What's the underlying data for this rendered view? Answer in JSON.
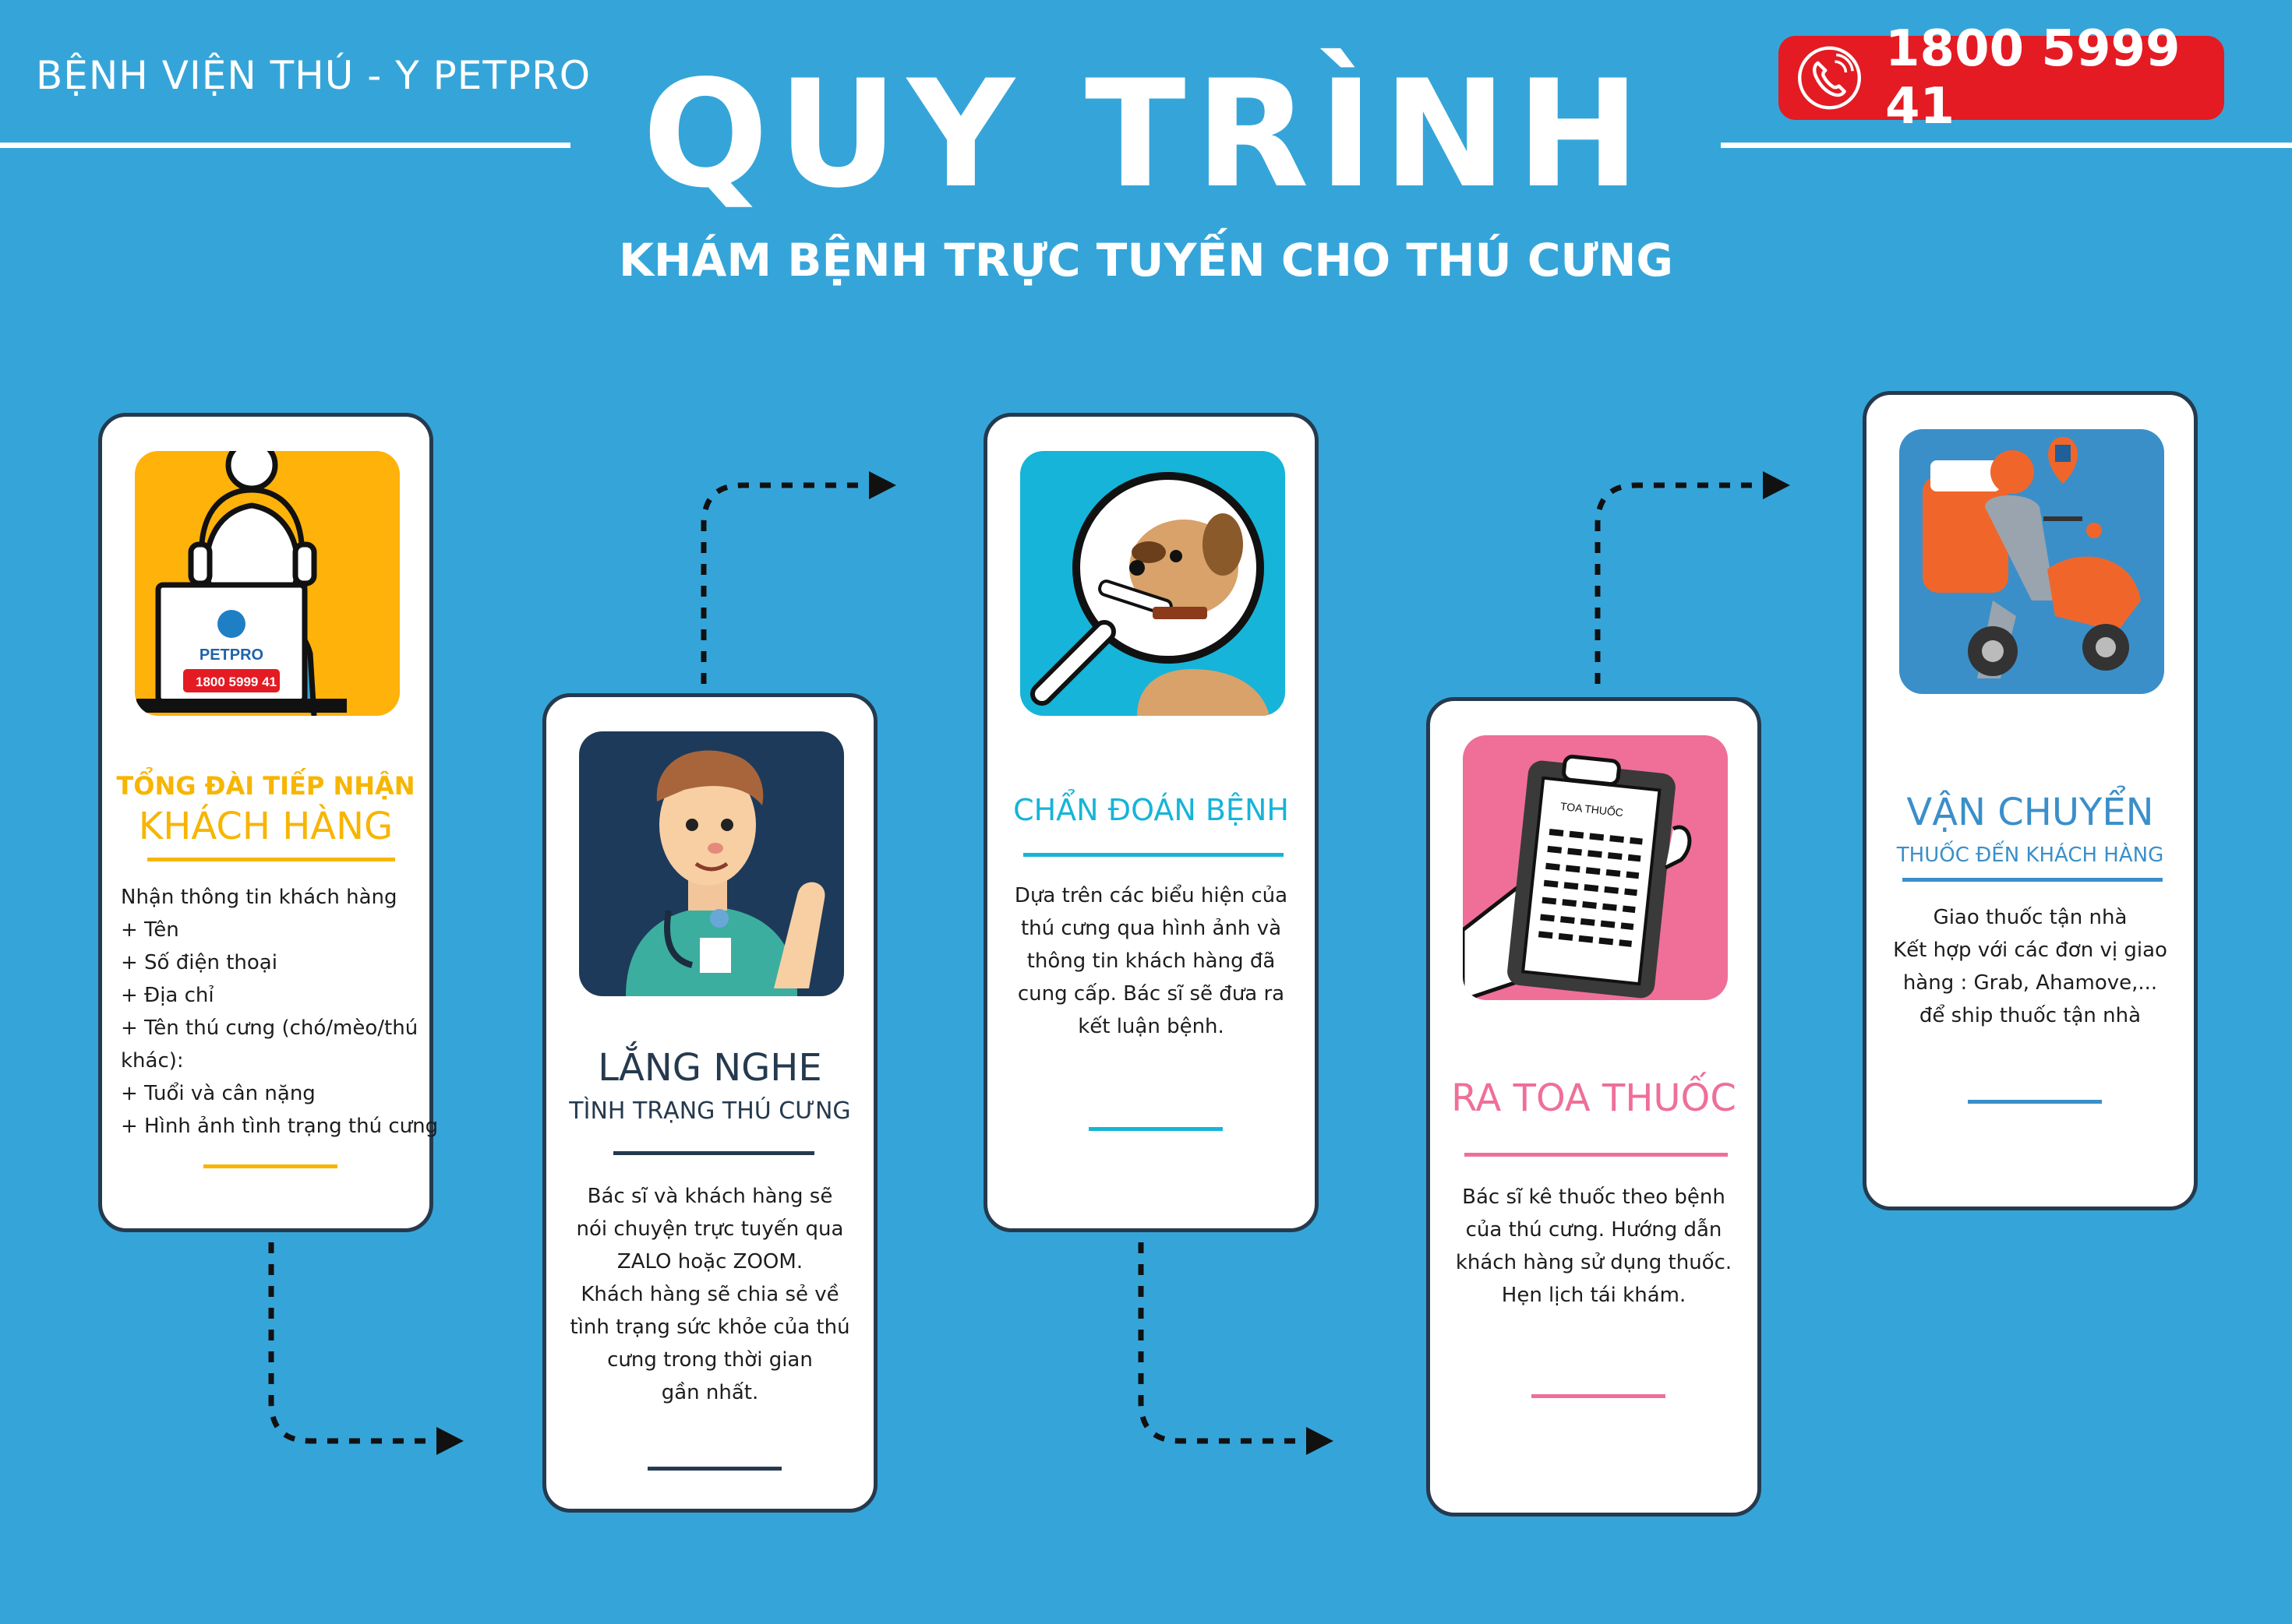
{
  "header": {
    "brand": "BỆNH VIỆN THÚ - Y PETPRO",
    "title": "QUY TRÌNH",
    "subtitle": "KHÁM BỆNH TRỰC TUYẾN CHO THÚ CƯNG",
    "hotline": "1800 5999 41"
  },
  "colors": {
    "background": "#35a5d9",
    "yellow": "#f7b500",
    "navy": "#253a4e",
    "cyan": "#16b4d8",
    "pink": "#ef6f98",
    "blue": "#3a8fc9",
    "red": "#e41b23"
  },
  "steps": [
    {
      "title_line1": "TỔNG ĐÀI TIẾP NHẬN",
      "title_line2": "KHÁCH HÀNG",
      "body": [
        "Nhận thông tin khách hàng",
        "+ Tên",
        "+ Số điện thoại",
        "+ Địa chỉ",
        "+ Tên thú cưng (chó/mèo/thú",
        "khác):",
        "+ Tuổi và cân nặng",
        "+ Hình ảnh tình trạng thú cưng"
      ],
      "icon": "call-center-operator",
      "laptop_brand": "PETPRO",
      "laptop_phone": "1800 5999 41"
    },
    {
      "title_line1": "LẮNG NGHE",
      "title_line2": "TÌNH TRẠNG THÚ CƯNG",
      "body": [
        "Bác sĩ và khách hàng sẽ",
        "nói chuyện trực tuyến qua",
        "ZALO hoặc ZOOM.",
        "Khách hàng sẽ chia sẻ về",
        "tình trạng sức khỏe của thú",
        "cưng trong thời gian",
        "gần nhất."
      ],
      "icon": "veterinarian"
    },
    {
      "title_line1": "CHẨN ĐOÁN BỆNH",
      "body": [
        "Dựa trên các biểu hiện của",
        "thú cưng qua hình ảnh và",
        "thông tin khách hàng đã",
        "cung cấp. Bác sĩ sẽ đưa ra",
        "kết luận bệnh."
      ],
      "icon": "magnifier-dog"
    },
    {
      "title_line1": "RA TOA THUỐC",
      "body": [
        "Bác sĩ kê thuốc theo bệnh",
        "của thú cưng. Hướng dẫn",
        "khách hàng sử dụng thuốc.",
        "Hẹn lịch tái khám."
      ],
      "icon": "prescription-clipboard",
      "clipboard_label": "TOA THUỐC"
    },
    {
      "title_line1": "VẬN CHUYỂN",
      "title_line2": "THUỐC ĐẾN KHÁCH HÀNG",
      "body": [
        "Giao thuốc tận nhà",
        "Kết hợp với các đơn vị giao",
        "hàng : Grab, Ahamove,...",
        "để ship thuốc tận nhà"
      ],
      "icon": "delivery-scooter"
    }
  ]
}
